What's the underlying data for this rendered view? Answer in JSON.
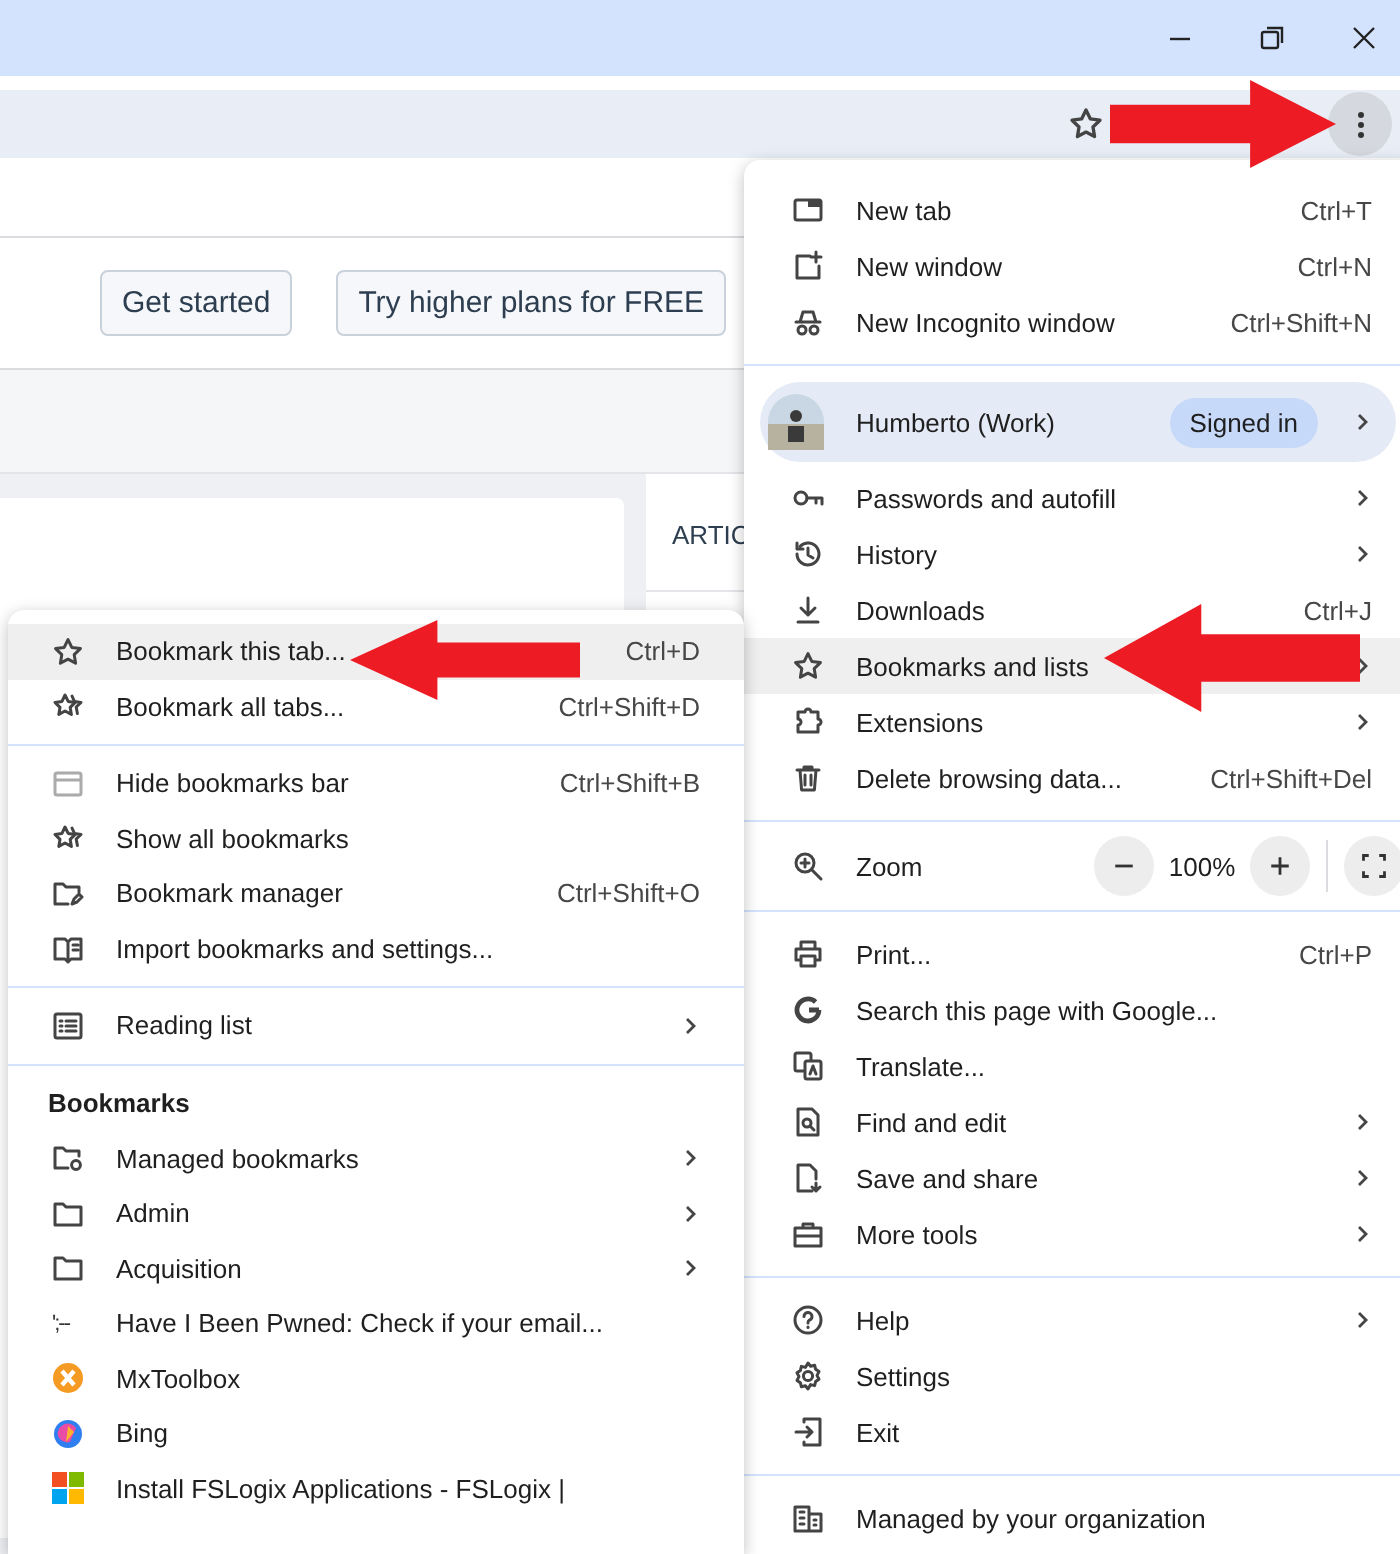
{
  "page": {
    "buttons": [
      "Get started",
      "Try higher plans for FREE"
    ],
    "sidebar_heading": "ARTIC"
  },
  "menu": {
    "sections": [
      [
        {
          "kind": "item",
          "label": "New tab",
          "shortcut": "Ctrl+T",
          "has_submenu": false,
          "selected": false
        },
        {
          "kind": "item",
          "label": "New window",
          "shortcut": "Ctrl+N",
          "has_submenu": false,
          "selected": false
        },
        {
          "kind": "item",
          "label": "New Incognito window",
          "shortcut": "Ctrl+Shift+N",
          "has_submenu": false,
          "selected": false
        }
      ],
      [
        {
          "kind": "profile",
          "label": "Humberto (Work)",
          "badge": "Signed in",
          "has_submenu": true
        },
        {
          "kind": "item",
          "label": "Passwords and autofill",
          "has_submenu": true,
          "selected": false
        },
        {
          "kind": "item",
          "label": "History",
          "has_submenu": true,
          "selected": false
        },
        {
          "kind": "item",
          "label": "Downloads",
          "shortcut": "Ctrl+J",
          "has_submenu": false,
          "selected": false
        },
        {
          "kind": "item",
          "label": "Bookmarks and lists",
          "has_submenu": true,
          "selected": true
        },
        {
          "kind": "item",
          "label": "Extensions",
          "has_submenu": true,
          "selected": false
        },
        {
          "kind": "item",
          "label": "Delete browsing data...",
          "shortcut": "Ctrl+Shift+Del",
          "has_submenu": false,
          "selected": false
        }
      ],
      [
        {
          "kind": "zoom",
          "label": "Zoom",
          "value": "100%"
        }
      ],
      [
        {
          "kind": "item",
          "label": "Print...",
          "shortcut": "Ctrl+P",
          "has_submenu": false,
          "selected": false
        },
        {
          "kind": "item",
          "label": "Search this page with Google...",
          "has_submenu": false,
          "selected": false
        },
        {
          "kind": "item",
          "label": "Translate...",
          "has_submenu": false,
          "selected": false
        },
        {
          "kind": "item",
          "label": "Find and edit",
          "has_submenu": true,
          "selected": false
        },
        {
          "kind": "item",
          "label": "Save and share",
          "has_submenu": true,
          "selected": false
        },
        {
          "kind": "item",
          "label": "More tools",
          "has_submenu": true,
          "selected": false
        }
      ],
      [
        {
          "kind": "item",
          "label": "Help",
          "has_submenu": true,
          "selected": false
        },
        {
          "kind": "item",
          "label": "Settings",
          "has_submenu": false,
          "selected": false
        },
        {
          "kind": "item",
          "label": "Exit",
          "has_submenu": false,
          "selected": false
        }
      ],
      [
        {
          "kind": "item",
          "label": "Managed by your organization",
          "has_submenu": false,
          "selected": false
        }
      ]
    ]
  },
  "submenu": {
    "sections": [
      [
        {
          "kind": "item",
          "label": "Bookmark this tab...",
          "shortcut": "Ctrl+D",
          "has_submenu": false,
          "selected": true
        },
        {
          "kind": "item",
          "label": "Bookmark all tabs...",
          "shortcut": "Ctrl+Shift+D",
          "has_submenu": false,
          "selected": false
        }
      ],
      [
        {
          "kind": "item",
          "label": "Hide bookmarks bar",
          "shortcut": "Ctrl+Shift+B",
          "has_submenu": false,
          "selected": false
        },
        {
          "kind": "item",
          "label": "Show all bookmarks",
          "has_submenu": false,
          "selected": false
        },
        {
          "kind": "item",
          "label": "Bookmark manager",
          "shortcut": "Ctrl+Shift+O",
          "has_submenu": false,
          "selected": false
        },
        {
          "kind": "item",
          "label": "Import bookmarks and settings...",
          "has_submenu": false,
          "selected": false
        }
      ],
      [
        {
          "kind": "item",
          "label": "Reading list",
          "has_submenu": true,
          "selected": false
        }
      ],
      [
        {
          "kind": "heading",
          "label": "Bookmarks"
        },
        {
          "kind": "item",
          "label": "Managed bookmarks",
          "has_submenu": true,
          "selected": false
        },
        {
          "kind": "item",
          "label": "Admin",
          "has_submenu": true,
          "selected": false
        },
        {
          "kind": "item",
          "label": "Acquisition",
          "has_submenu": true,
          "selected": false
        },
        {
          "kind": "item",
          "label": "Have I Been Pwned: Check if your email...",
          "icon_text": "';--",
          "has_submenu": false,
          "selected": false
        },
        {
          "kind": "item",
          "label": "MxToolbox",
          "has_submenu": false,
          "selected": false
        },
        {
          "kind": "item",
          "label": "Bing",
          "has_submenu": false,
          "selected": false
        },
        {
          "kind": "item",
          "label": "Install FSLogix Applications - FSLogix |",
          "has_submenu": false,
          "selected": false
        }
      ]
    ]
  }
}
